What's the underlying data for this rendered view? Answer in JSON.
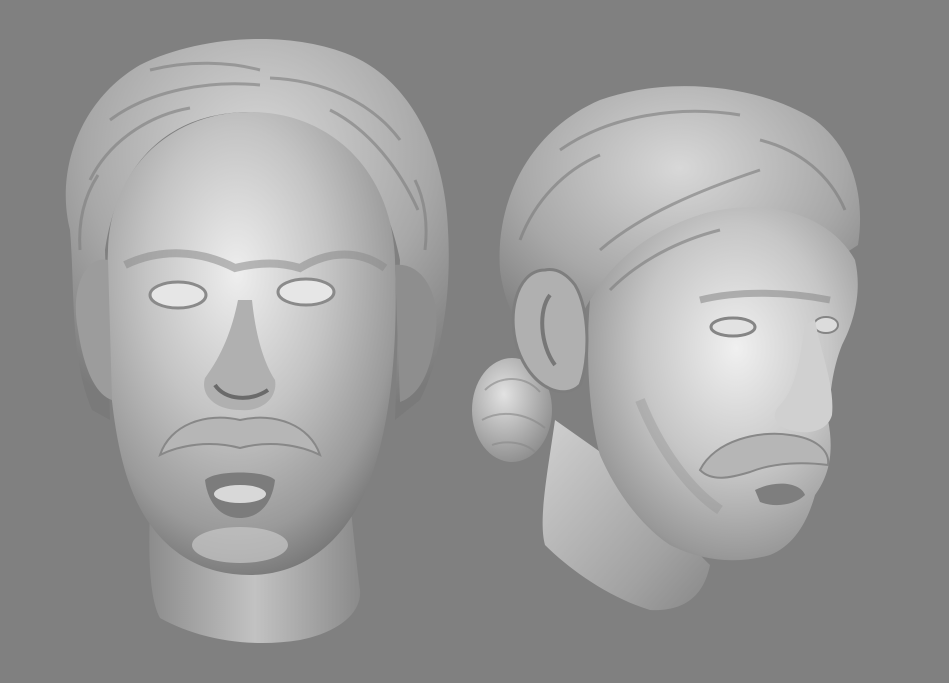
{
  "scene": {
    "background_color": "#808080",
    "material_color": "#b8b8b8",
    "models": [
      {
        "view": "front",
        "description_icon": "sculpted-head-front-icon"
      },
      {
        "view": "three-quarter-right",
        "description_icon": "sculpted-head-profile-icon"
      }
    ]
  }
}
